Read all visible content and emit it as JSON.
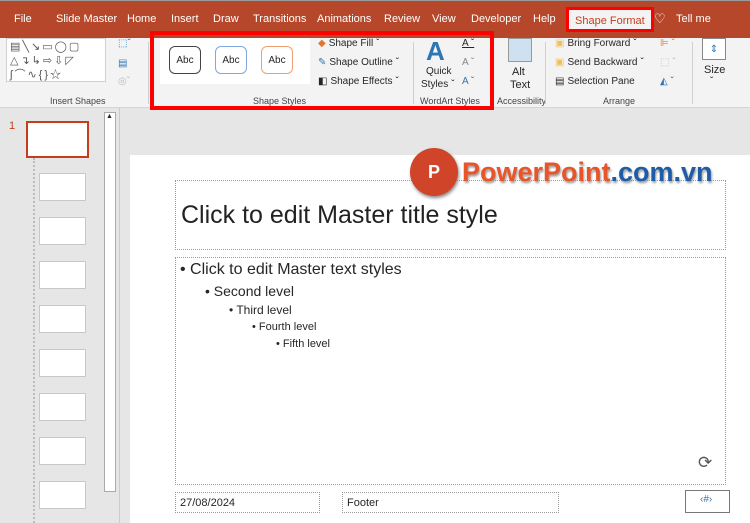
{
  "tabs": [
    "File",
    "Slide Master",
    "Home",
    "Insert",
    "Draw",
    "Transitions",
    "Animations",
    "Review",
    "View",
    "Developer",
    "Help"
  ],
  "active_tab": "Shape Format",
  "tell_me": "Tell me",
  "ribbon": {
    "insert_shapes": "Insert Shapes",
    "shape_styles": {
      "label": "Shape Styles",
      "samples": [
        "Abc",
        "Abc",
        "Abc"
      ],
      "fill": "Shape Fill",
      "outline": "Shape Outline",
      "effects": "Shape Effects"
    },
    "wordart": {
      "label": "WordArt Styles",
      "quick_styles_1": "Quick",
      "quick_styles_2": "Styles"
    },
    "accessibility": {
      "label": "Accessibility",
      "alt_1": "Alt",
      "alt_2": "Text"
    },
    "arrange": {
      "label": "Arrange",
      "bring_forward": "Bring Forward",
      "send_backward": "Send Backward",
      "selection_pane": "Selection Pane"
    },
    "size": "Size"
  },
  "thumbnails": {
    "selected_number": "1",
    "count": 9
  },
  "watermark": {
    "brand": "PowerPoint",
    ".com.vn": ".com.vn"
  },
  "slide": {
    "title": "Click to edit Master title style",
    "levels": [
      "Click to edit Master text styles",
      "Second level",
      "Third level",
      "Fourth level",
      "Fifth level"
    ],
    "date": "27/08/2024",
    "footer": "Footer",
    "number": "‹#›"
  },
  "colors": {
    "accent": "#b7472a",
    "highlight": "#ff0000",
    "wordart_blue": "#2e75b6"
  }
}
